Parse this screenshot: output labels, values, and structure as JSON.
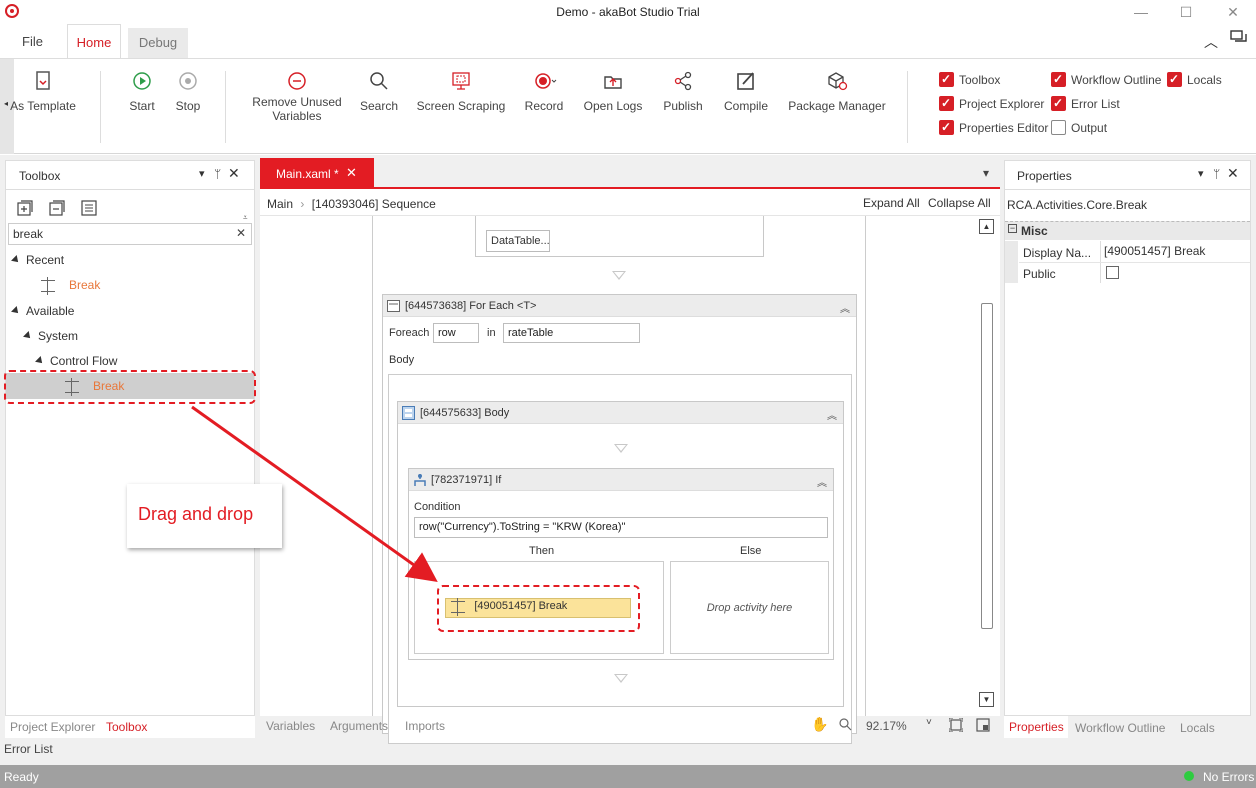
{
  "window": {
    "title": "Demo - akaBot Studio Trial",
    "minimize": "—",
    "maximize": "☐",
    "close": "✕"
  },
  "ribbon_tabs": {
    "file": "File",
    "home": "Home",
    "debug": "Debug"
  },
  "ribbon": {
    "as_template": "As Template",
    "start": "Start",
    "stop": "Stop",
    "remove_unused_1": "Remove Unused",
    "remove_unused_2": "Variables",
    "search": "Search",
    "screen_scraping": "Screen Scraping",
    "record": "Record",
    "open_logs": "Open Logs",
    "publish": "Publish",
    "compile": "Compile",
    "package_manager": "Package Manager"
  },
  "panel_toggles": [
    {
      "label": "Toolbox",
      "checked": true
    },
    {
      "label": "Workflow Outline",
      "checked": true
    },
    {
      "label": "Locals",
      "checked": true
    },
    {
      "label": "Project Explorer",
      "checked": true
    },
    {
      "label": "Error List",
      "checked": true
    },
    {
      "label": "Properties Editor",
      "checked": true
    },
    {
      "label": "Output",
      "checked": false
    }
  ],
  "toolbox": {
    "title": "Toolbox",
    "search_value": "break",
    "recent": "Recent",
    "recent_item": "Break",
    "available": "Available",
    "system": "System",
    "control_flow": "Control Flow",
    "break_item": "Break"
  },
  "designer": {
    "tab_label": "Main.xaml *",
    "breadcrumb_main": "Main",
    "breadcrumb_seq": "[140393046] Sequence",
    "expand_all": "Expand All",
    "collapse_all": "Collapse All",
    "datatable_btn": "DataTable...",
    "foreach_title": "[644573638] For Each <T>",
    "foreach_label": "Foreach",
    "foreach_var": "row",
    "in_label": "in",
    "foreach_collection": "rateTable",
    "body_label": "Body",
    "body_title": "[644575633] Body",
    "if_title": "[782371971] If",
    "condition_label": "Condition",
    "condition_value": "row(\"Currency\").ToString = \"KRW (Korea)\"",
    "then_label": "Then",
    "else_label": "Else",
    "break_activity": "[490051457] Break",
    "drop_hint": "Drop activity here",
    "zoom": "92.17%"
  },
  "designer_bottom_tabs": {
    "variables": "Variables",
    "arguments": "Arguments",
    "imports": "Imports"
  },
  "callout": "Drag and drop",
  "properties": {
    "title": "Properties",
    "class_name": "RCA.Activities.Core.Break",
    "section": "Misc",
    "display_name_label": "Display Na...",
    "display_name_value": "[490051457] Break",
    "public_label": "Public"
  },
  "left_bottom_tabs": {
    "project_explorer": "Project Explorer",
    "toolbox": "Toolbox"
  },
  "right_bottom_tabs": {
    "properties": "Properties",
    "workflow_outline": "Workflow Outline",
    "locals": "Locals"
  },
  "error_list_tab": "Error List",
  "status": {
    "left": "Ready",
    "right": "No Errors"
  },
  "colors": {
    "accent": "#d61f26",
    "highlight": "#fbe39a",
    "status_ok": "#2ecc40"
  }
}
